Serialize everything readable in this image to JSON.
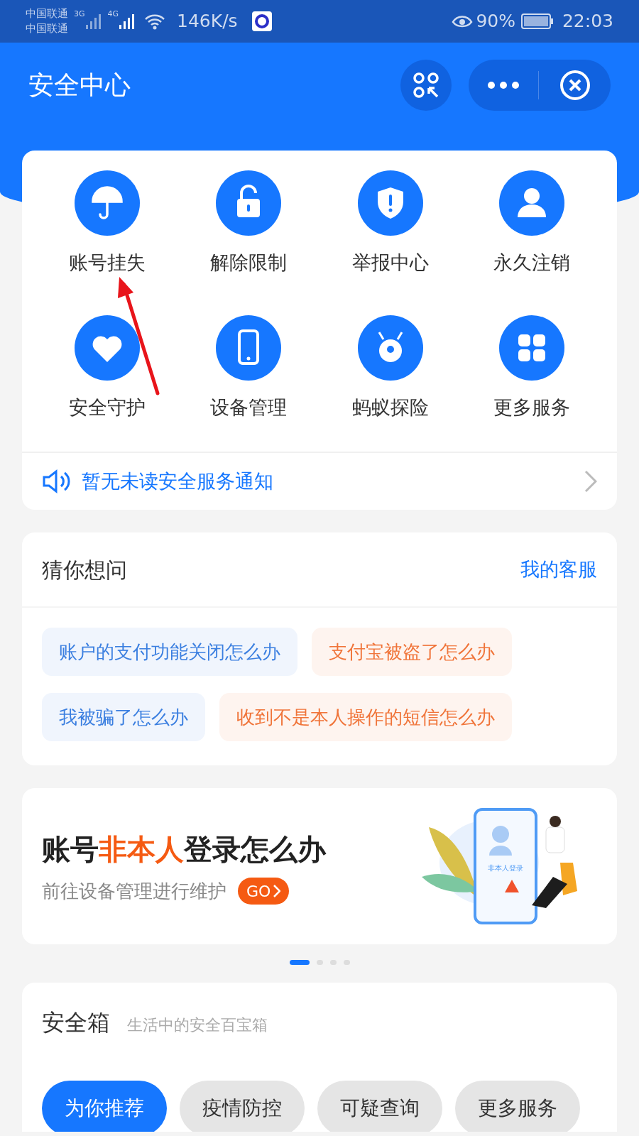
{
  "status_bar": {
    "carriers": [
      "中国联通",
      "中国联通"
    ],
    "net_3g": "3G",
    "net_4g": "4G",
    "speed": "146K/s",
    "battery": "90%",
    "time": "22:03"
  },
  "header": {
    "title": "安全中心"
  },
  "services": [
    {
      "label": "账号挂失",
      "kind": "umbrella"
    },
    {
      "label": "解除限制",
      "kind": "unlock"
    },
    {
      "label": "举报中心",
      "kind": "shield"
    },
    {
      "label": "永久注销",
      "kind": "user"
    },
    {
      "label": "安全守护",
      "kind": "heart"
    },
    {
      "label": "设备管理",
      "kind": "phone"
    },
    {
      "label": "蚂蚁探险",
      "kind": "ant"
    },
    {
      "label": "更多服务",
      "kind": "grid"
    }
  ],
  "notice": "暂无未读安全服务通知",
  "faq": {
    "title": "猜你想问",
    "link": "我的客服",
    "questions": [
      {
        "text": "账户的支付功能关闭怎么办",
        "color": "#3b7fe0"
      },
      {
        "text": "支付宝被盗了怎么办",
        "color": "#f07439"
      },
      {
        "text": "我被骗了怎么办",
        "color": "#3b7fe0"
      },
      {
        "text": "收到不是本人操作的短信怎么办",
        "color": "#f07439"
      }
    ]
  },
  "banner": {
    "title_parts": [
      {
        "text": "账号",
        "highlight": false
      },
      {
        "text": "非本人",
        "highlight": true
      },
      {
        "text": "登录怎么办",
        "highlight": false
      }
    ],
    "subtitle": "前往设备管理进行维护",
    "go": "GO",
    "illustration_label": "非本人登录",
    "pages": [
      {
        "selected": true
      },
      {
        "selected": false
      },
      {
        "selected": false
      },
      {
        "selected": false
      }
    ]
  },
  "safebox": {
    "title": "安全箱",
    "subtitle": "生活中的安全百宝箱",
    "tabs": [
      {
        "label": "为你推荐",
        "selected": true
      },
      {
        "label": "疫情防控",
        "selected": false
      },
      {
        "label": "可疑查询",
        "selected": false
      },
      {
        "label": "更多服务",
        "selected": false
      }
    ]
  }
}
